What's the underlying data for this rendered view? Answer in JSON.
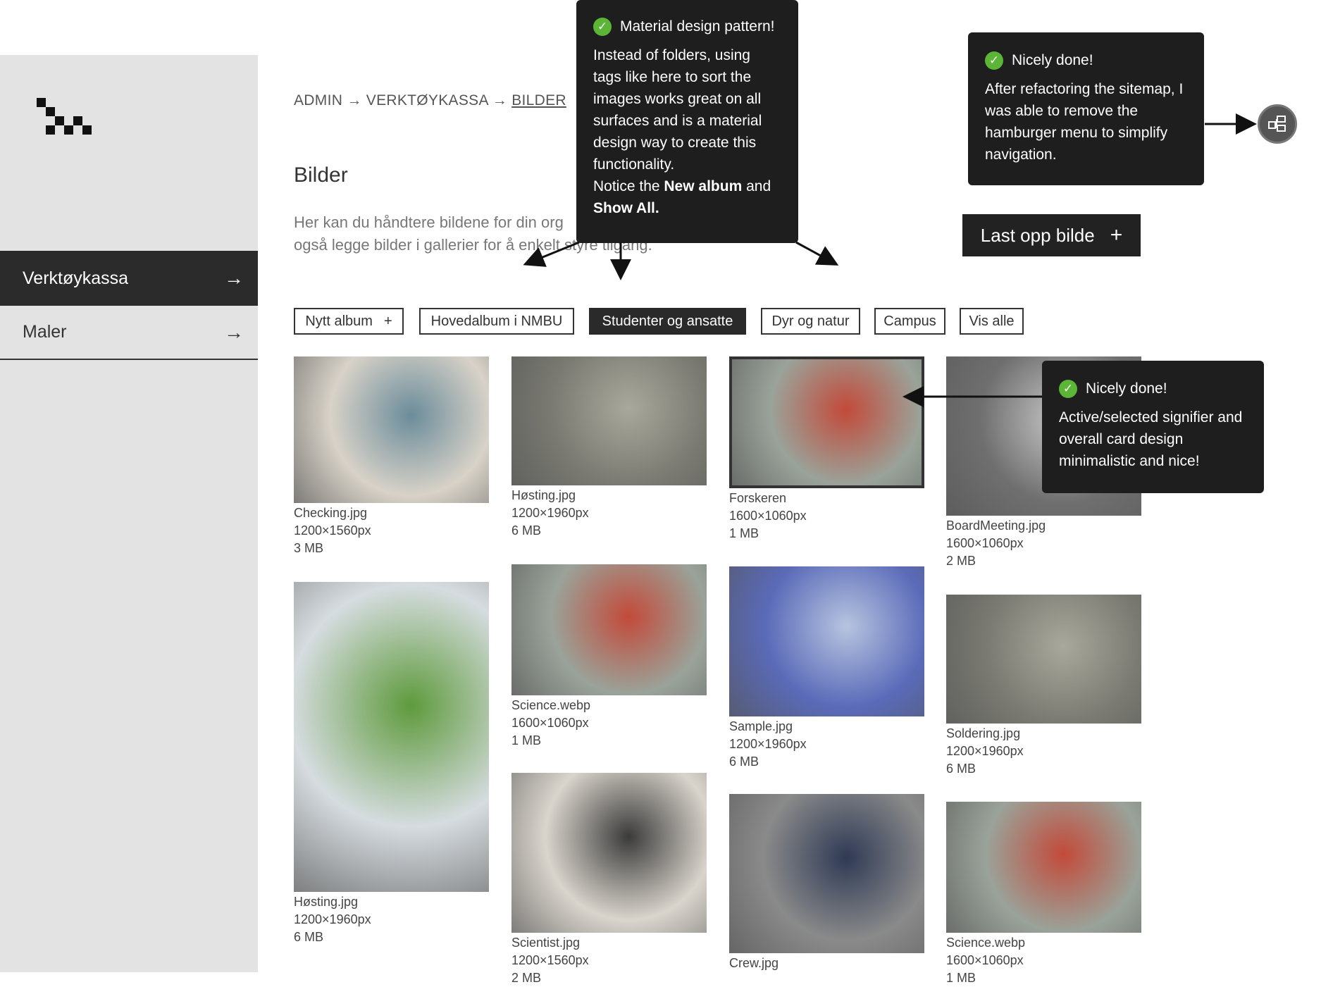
{
  "sidebar": {
    "items": [
      {
        "label": "Verktøykassa",
        "arrow": "→"
      },
      {
        "label": "Maler",
        "arrow": "→"
      }
    ]
  },
  "breadcrumb": {
    "part1": "ADMIN",
    "sep": "→",
    "part2": "VERKTØYKASSA",
    "current": "BILDER"
  },
  "page": {
    "title": "Bilder",
    "description_line1": "Her kan du håndtere bildene for din org",
    "description_line2": "også legge bilder i gallerier for å enkelt styre tilgang."
  },
  "upload_button": {
    "label": "Last opp bilde",
    "icon": "+"
  },
  "tags": [
    {
      "label": "Nytt album",
      "icon": "+"
    },
    {
      "label": "Hovedalbum i NMBU"
    },
    {
      "label": "Studenter og ansatte",
      "selected": true
    },
    {
      "label": "Dyr og natur"
    },
    {
      "label": "Campus"
    },
    {
      "label": "Vis alle"
    }
  ],
  "images": [
    {
      "name": "Checking.jpg",
      "dims": "1200×1560px",
      "size": "3 MB",
      "palette": [
        "#d8d2c8",
        "#6b8c9a"
      ]
    },
    {
      "name": "Høsting.jpg",
      "dims": "1200×1960px",
      "size": "6 MB",
      "palette": [
        "#7a7a72",
        "#a8a89c"
      ]
    },
    {
      "name": "Forskeren",
      "dims": "1600×1060px",
      "size": "1 MB",
      "palette": [
        "#9aa39a",
        "#c34a3a"
      ]
    },
    {
      "name": "BoardMeeting.jpg",
      "dims": "1600×1060px",
      "size": "2 MB",
      "palette": [
        "#6f6f6f",
        "#c8c8c8"
      ]
    },
    {
      "name": "Høsting.jpg",
      "dims": "1200×1960px",
      "size": "6 MB",
      "palette": [
        "#d6dce0",
        "#5e9a3c"
      ]
    },
    {
      "name": "Science.webp",
      "dims": "1600×1060px",
      "size": "1 MB",
      "palette": [
        "#9aa39a",
        "#c34a3a"
      ]
    },
    {
      "name": "Sample.jpg",
      "dims": "1200×1960px",
      "size": "6 MB",
      "palette": [
        "#5a6ab8",
        "#b7c4e0"
      ]
    },
    {
      "name": "Soldering.jpg",
      "dims": "1200×1960px",
      "size": "6 MB",
      "palette": [
        "#7a7a72",
        "#a8a89c"
      ]
    },
    {
      "name": "Scientist.jpg",
      "dims": "1200×1560px",
      "size": "2 MB",
      "palette": [
        "#d9d4cc",
        "#3b3b3b"
      ]
    },
    {
      "name": "Crew.jpg",
      "dims": "",
      "size": "",
      "palette": [
        "#8a8a8a",
        "#2f3a55"
      ]
    },
    {
      "name": "Science.webp",
      "dims": "1600×1060px",
      "size": "1 MB",
      "palette": [
        "#9aa39a",
        "#c34a3a"
      ]
    }
  ],
  "callouts": {
    "material": {
      "title": "Material design pattern!",
      "body": "Instead of folders, using tags like here to sort the images works great on all surfaces and is a material design way to create this functionality.",
      "notice_pre": "Notice the ",
      "notice_b1": "New album",
      "notice_mid": " and",
      "notice_b2": "Show All."
    },
    "sitemap": {
      "title": "Nicely done!",
      "body": "After refactoring the sitemap, I was able to remove the hamburger menu to simplify navigation."
    },
    "card": {
      "title": "Nicely done!",
      "body": "Active/selected  signifier and overall card design minimalistic and nice!"
    }
  },
  "colors": {
    "dark": "#1e1e1e",
    "check": "#5bb536",
    "sidebar": "#e3e3e3"
  }
}
